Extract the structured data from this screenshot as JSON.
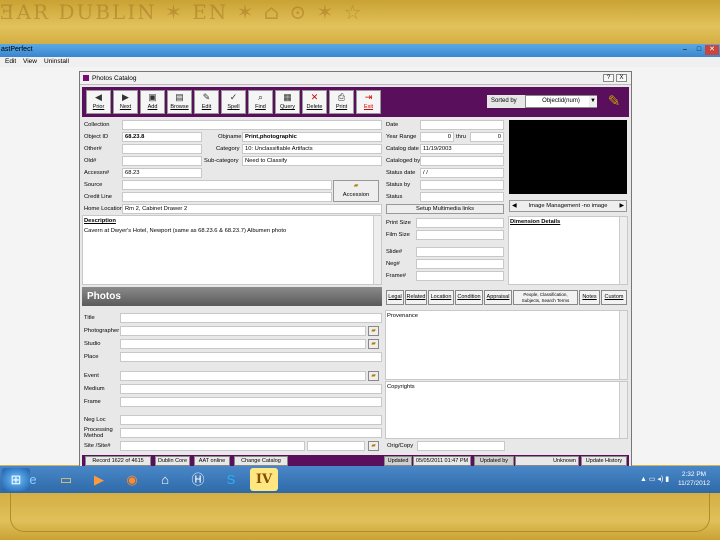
{
  "app": {
    "title": "astPerfect",
    "menu": [
      "Edit",
      "View",
      "Uninstall"
    ]
  },
  "catalog_window": {
    "title": "Photos Catalog",
    "help_btn": "?",
    "close_btn": "X"
  },
  "toolbar": {
    "buttons": [
      {
        "label": "Prior",
        "icon": "◀"
      },
      {
        "label": "Next",
        "icon": "▶"
      },
      {
        "label": "Add",
        "icon": "▣"
      },
      {
        "label": "Browse",
        "icon": "▤"
      },
      {
        "label": "Edit",
        "icon": "✎"
      },
      {
        "label": "Spell",
        "icon": "✓"
      },
      {
        "label": "Find",
        "icon": "⌕"
      },
      {
        "label": "Query",
        "icon": "▦"
      },
      {
        "label": "Delete",
        "icon": "✕"
      },
      {
        "label": "Print",
        "icon": "⎙"
      },
      {
        "label": "Exit",
        "icon": "⇥"
      }
    ],
    "sorted_label": "Sorted by",
    "sorted_value": "Objectid(num)"
  },
  "fields": {
    "collection_lbl": "Collection",
    "objectid_lbl": "Object ID",
    "objectid": "68.23.8",
    "objname_lbl": "Objname",
    "objname": "Print,photographic",
    "other_lbl": "Other#",
    "category_lbl": "Category",
    "category": "10: Unclassifiable Artifacts",
    "old_lbl": "Old#",
    "subcategory_lbl": "Sub-category",
    "subcategory": "Need to Classify",
    "accession_lbl": "Accessn#",
    "accession": "68.23",
    "source_lbl": "Source",
    "creditline_lbl": "Credit Line",
    "accession_btn": "Accession",
    "homelocation_lbl": "Home Location",
    "homelocation": "Rm 2, Cabinet Drawer 2",
    "description_lbl": "Description",
    "description": "Cavern at Dwyer's Hotel, Newport  (same as 68.23.6 & 68.23.7)    Albumen photo",
    "date_lbl": "Date",
    "yearrange_lbl": "Year Range",
    "year_from": "0",
    "thru_lbl": "thru",
    "year_to": "0",
    "catalogdate_lbl": "Catalog date",
    "catalogdate": "11/19/2003",
    "catalogedby_lbl": "Cataloged by",
    "statusdate_lbl": "Status date",
    "statusdate": " / /",
    "statusby_lbl": "Status by",
    "status_lbl": "Status",
    "multimedia_btn": "Setup Multimedia links",
    "imagemgmt": "Image Management -no image",
    "printsize_lbl": "Print Size",
    "filmsize_lbl": "Film Size",
    "dimension_lbl": "Dimension Details",
    "slide_lbl": "Slide#",
    "neg_lbl": "Neg#",
    "frame_lbl": "Frame#"
  },
  "photos_section": {
    "band": "Photos",
    "title_lbl": "Title",
    "photographer_lbl": "Photographer",
    "studio_lbl": "Studio",
    "place_lbl": "Place",
    "event_lbl": "Event",
    "medium_lbl": "Medium",
    "frame_lbl": "Frame",
    "negloc_lbl": "Neg Loc",
    "processing_lbl": "Processing Method",
    "site_lbl": "Site /Site#"
  },
  "tabs": [
    "Legal",
    "Related",
    "Location",
    "Condition",
    "Appraisal",
    "People, Classification, Subjects, Search Terms",
    "Notes",
    "Custom"
  ],
  "right_panel": {
    "provenance_lbl": "Provenance",
    "copyrights_lbl": "Copyrights",
    "origcopy_lbl": "Orig/Copy"
  },
  "statusbar": {
    "record": "Record 1622 of 4615",
    "dublin": "Dublin Core",
    "aat": "AAT online",
    "change": "Change Catalog",
    "updated_lbl": "Updated",
    "updated": "05/05/2011 01:47 PM",
    "updatedby_lbl": "Updated by",
    "updatedby": "Unknown",
    "history": "Update History"
  },
  "taskbar": {
    "time": "2:32 PM",
    "date": "11/27/2012",
    "apps": [
      "windows-start",
      "ie",
      "explorer",
      "media-player",
      "firefox",
      "paint",
      "hp",
      "skype",
      "s-app",
      "pastperfect"
    ]
  }
}
